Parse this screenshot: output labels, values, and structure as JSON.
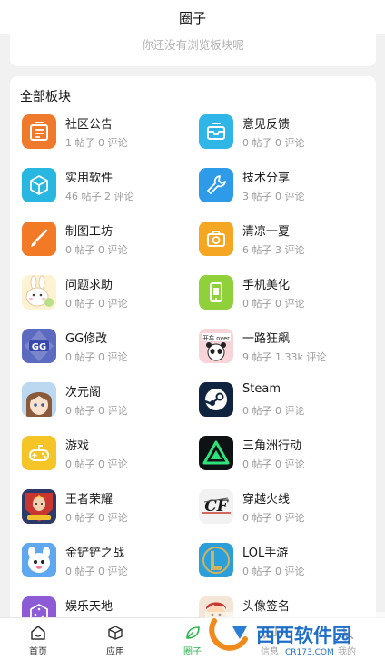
{
  "header": {
    "title": "圈子"
  },
  "recent": {
    "empty_text": "你还没有浏览板块呢"
  },
  "all_boards": {
    "title": "全部板块",
    "items": [
      {
        "name": "社区公告",
        "stats": "1 帖子 0 评论",
        "icon": "announcement-icon",
        "color": "#f07a2b"
      },
      {
        "name": "意见反馈",
        "stats": "0 帖子 0 评论",
        "icon": "mailbox-icon",
        "color": "#2fb6e6"
      },
      {
        "name": "实用软件",
        "stats": "46 帖子 2 评论",
        "icon": "cube-icon",
        "color": "#28b7e0"
      },
      {
        "name": "技术分享",
        "stats": "3 帖子 0 评论",
        "icon": "wrench-icon",
        "color": "#2e9be8"
      },
      {
        "name": "制图工坊",
        "stats": "0 帖子 0 评论",
        "icon": "brush-icon",
        "color": "#f27a26"
      },
      {
        "name": "清凉一夏",
        "stats": "6 帖子 3 评论",
        "icon": "camera-icon",
        "color": "#f5a623"
      },
      {
        "name": "问题求助",
        "stats": "0 帖子 0 评论",
        "icon": "bunny-icon",
        "color": "#fdf3d2"
      },
      {
        "name": "手机美化",
        "stats": "0 帖子 0 评论",
        "icon": "phone-icon",
        "color": "#8fd03b"
      },
      {
        "name": "GG修改",
        "stats": "0 帖子 0 评论",
        "icon": "gg-icon",
        "color": "#5c6bc0"
      },
      {
        "name": "一路狂飙",
        "stats": "9 帖子 1.33k 评论",
        "icon": "panda-icon",
        "color": "#f6d4d8"
      },
      {
        "name": "次元阁",
        "stats": "0 帖子 0 评论",
        "icon": "anime-icon",
        "color": "#9ec5e8"
      },
      {
        "name": "Steam",
        "stats": "0 帖子 0 评论",
        "icon": "steam-icon",
        "color": "#10233f"
      },
      {
        "name": "游戏",
        "stats": "0 帖子 0 评论",
        "icon": "gamepad-icon",
        "color": "#f5c527"
      },
      {
        "name": "三角洲行动",
        "stats": "0 帖子 0 评论",
        "icon": "delta-icon",
        "color": "#0e1214"
      },
      {
        "name": "王者荣耀",
        "stats": "0 帖子 0 评论",
        "icon": "honor-icon",
        "color": "#c8372f"
      },
      {
        "name": "穿越火线",
        "stats": "0 帖子 0 评论",
        "icon": "crossfire-icon",
        "color": "#f2f2f2"
      },
      {
        "name": "金铲铲之战",
        "stats": "0 帖子 0 评论",
        "icon": "shovel-icon",
        "color": "#3a7fd9"
      },
      {
        "name": "LOL手游",
        "stats": "0 帖子 0 评论",
        "icon": "lol-icon",
        "color": "#2a9fd9"
      },
      {
        "name": "娱乐天地",
        "stats": "",
        "icon": "dice-icon",
        "color": "#8e5bd6"
      },
      {
        "name": "头像签名",
        "stats": "",
        "icon": "avatar-icon",
        "color": "#f3e6d6"
      }
    ]
  },
  "tabbar": {
    "tabs": [
      {
        "label": "首页",
        "icon": "home-icon"
      },
      {
        "label": "应用",
        "icon": "box-icon"
      },
      {
        "label": "圈子",
        "icon": "leaf-icon"
      },
      {
        "label": "信息",
        "icon": "message-icon"
      },
      {
        "label": "我的",
        "icon": "user-icon"
      }
    ],
    "active_color": "#2bb34b"
  },
  "watermark": {
    "text": "西西软件园",
    "sub": "CR173.COM"
  }
}
